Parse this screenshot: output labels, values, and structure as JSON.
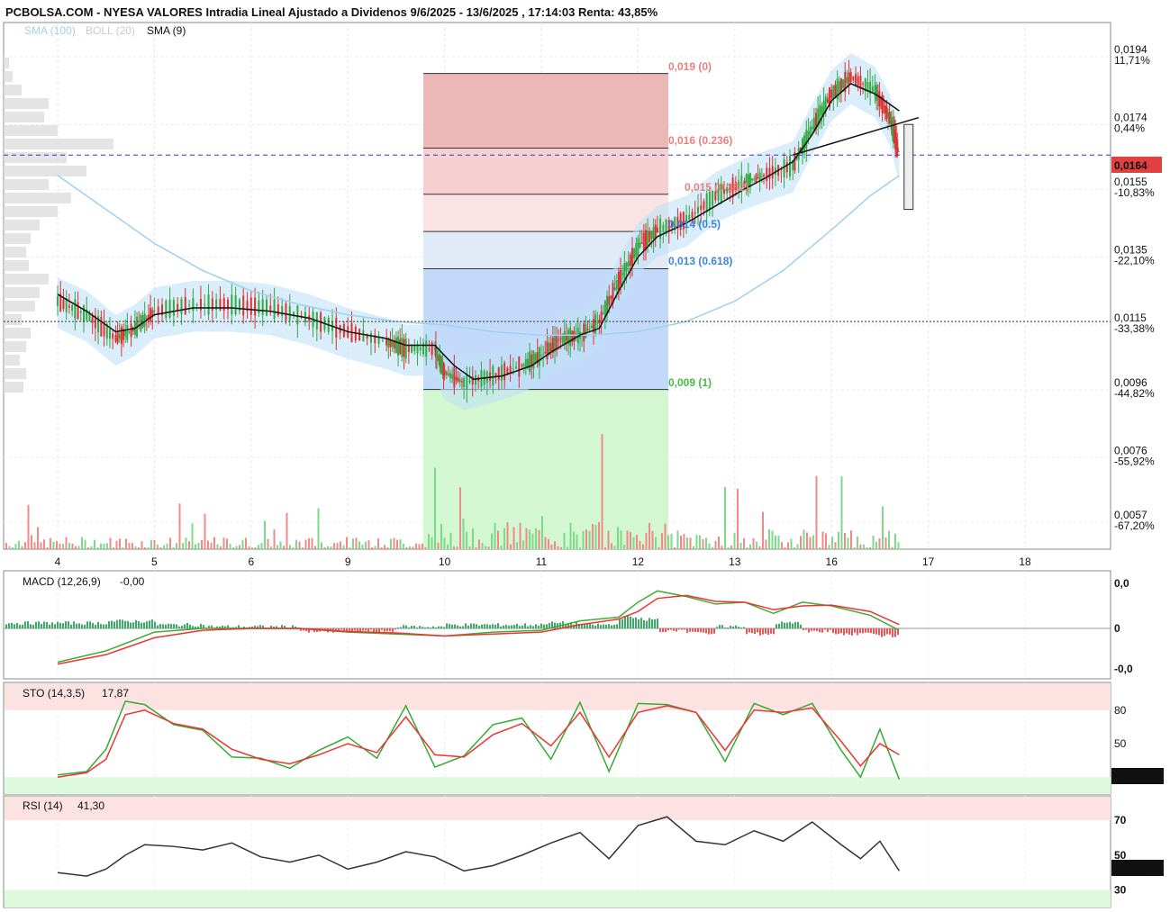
{
  "chart_data": [
    {
      "type": "candlestick",
      "title": "PCBOLSA.COM - NYESA VALORES Intradia Lineal Ajustado a Dividenos 9/6/2025 - 13/6/2025 , 17:14:03 Renta: 43,85%",
      "legend": [
        "SMA (100)",
        "BOLL (20)",
        "SMA (9)"
      ],
      "x_ticks": [
        "4",
        "5",
        "6",
        "9",
        "10",
        "11",
        "12",
        "13",
        "16",
        "17",
        "18"
      ],
      "y_ticks": [
        "0,0194",
        "0,0174",
        "0,0155",
        "0,0135",
        "0,0115",
        "0,0096",
        "0,0076",
        "0,0057"
      ],
      "y_pct": [
        "11,71%",
        "0,44%",
        "-10,83%",
        "-22,10%",
        "-33,38%",
        "-44,82%",
        "-55,92%",
        "-67,20%"
      ],
      "ylim": [
        0.0048,
        0.0203
      ],
      "last_price": "0,0164",
      "last_value": 0.0164,
      "reference_value": 0.0115,
      "fibonacci": {
        "high": 0.0188,
        "low": 0.0095,
        "labels": [
          "0,019 (0)",
          "0,016 (0.236)",
          "0,015 (0.382)",
          "0,014 (0.5)",
          "0,013 (0.618)",
          "0,009 (1)"
        ],
        "ratios": [
          0,
          0.236,
          0.382,
          0.5,
          0.618,
          1
        ]
      },
      "price_line": [
        [
          0,
          0.0121
        ],
        [
          0.3,
          0.0117
        ],
        [
          0.6,
          0.011
        ],
        [
          0.8,
          0.0113
        ],
        [
          1.0,
          0.0118
        ],
        [
          1.4,
          0.012
        ],
        [
          1.8,
          0.012
        ],
        [
          2.2,
          0.0119
        ],
        [
          2.6,
          0.0116
        ],
        [
          3.0,
          0.0112
        ],
        [
          3.4,
          0.0109
        ],
        [
          3.6,
          0.0107
        ],
        [
          3.9,
          0.0107
        ],
        [
          4.0,
          0.01
        ],
        [
          4.2,
          0.0097
        ],
        [
          4.5,
          0.0099
        ],
        [
          4.8,
          0.0102
        ],
        [
          5.0,
          0.0105
        ],
        [
          5.2,
          0.011
        ],
        [
          5.4,
          0.0111
        ],
        [
          5.6,
          0.0115
        ],
        [
          5.8,
          0.0127
        ],
        [
          6.0,
          0.0137
        ],
        [
          6.2,
          0.0142
        ],
        [
          6.5,
          0.0145
        ],
        [
          6.8,
          0.0152
        ],
        [
          7.1,
          0.0156
        ],
        [
          7.3,
          0.0158
        ],
        [
          7.6,
          0.0161
        ],
        [
          7.8,
          0.0172
        ],
        [
          8.0,
          0.0182
        ],
        [
          8.2,
          0.0187
        ],
        [
          8.45,
          0.0183
        ],
        [
          8.6,
          0.0175
        ],
        [
          8.7,
          0.0164
        ]
      ],
      "sma9": [
        [
          0,
          0.0123
        ],
        [
          0.3,
          0.0118
        ],
        [
          0.6,
          0.0112
        ],
        [
          0.8,
          0.0113
        ],
        [
          1.0,
          0.0117
        ],
        [
          1.4,
          0.0119
        ],
        [
          1.8,
          0.0119
        ],
        [
          2.2,
          0.0118
        ],
        [
          2.6,
          0.0116
        ],
        [
          3.0,
          0.0112
        ],
        [
          3.4,
          0.011
        ],
        [
          3.6,
          0.0108
        ],
        [
          3.9,
          0.0108
        ],
        [
          4.1,
          0.0102
        ],
        [
          4.3,
          0.0098
        ],
        [
          4.6,
          0.0099
        ],
        [
          4.9,
          0.0102
        ],
        [
          5.1,
          0.0106
        ],
        [
          5.4,
          0.0111
        ],
        [
          5.6,
          0.0113
        ],
        [
          5.8,
          0.0124
        ],
        [
          6.0,
          0.0134
        ],
        [
          6.2,
          0.014
        ],
        [
          6.5,
          0.0144
        ],
        [
          6.8,
          0.0149
        ],
        [
          7.1,
          0.0154
        ],
        [
          7.3,
          0.0157
        ],
        [
          7.6,
          0.0162
        ],
        [
          7.8,
          0.017
        ],
        [
          8.0,
          0.018
        ],
        [
          8.2,
          0.0185
        ],
        [
          8.45,
          0.0182
        ],
        [
          8.7,
          0.0177
        ]
      ],
      "sma100": [
        [
          0,
          0.0158
        ],
        [
          0.5,
          0.0148
        ],
        [
          1.0,
          0.0138
        ],
        [
          1.5,
          0.013
        ],
        [
          2.0,
          0.0124
        ],
        [
          2.5,
          0.012
        ],
        [
          3.0,
          0.0117
        ],
        [
          3.5,
          0.0115
        ],
        [
          4.0,
          0.0114
        ],
        [
          4.5,
          0.0112
        ],
        [
          5.0,
          0.0111
        ],
        [
          5.5,
          0.0111
        ],
        [
          6.0,
          0.0112
        ],
        [
          6.5,
          0.0115
        ],
        [
          7.0,
          0.0121
        ],
        [
          7.5,
          0.013
        ],
        [
          8.0,
          0.0142
        ],
        [
          8.4,
          0.0152
        ],
        [
          8.7,
          0.0158
        ]
      ],
      "trendline": [
        [
          7.6,
          0.0164
        ],
        [
          8.9,
          0.0175
        ]
      ]
    },
    {
      "type": "line",
      "title": "MACD (12,26,9)",
      "value": "-0,00",
      "y_ticks": [
        "0,0",
        "0",
        "-0,0"
      ],
      "macd": [
        [
          0,
          -0.9
        ],
        [
          0.5,
          -0.6
        ],
        [
          1.0,
          -0.1
        ],
        [
          1.5,
          0.0
        ],
        [
          2.0,
          0.0
        ],
        [
          2.5,
          0.0
        ],
        [
          3.0,
          -0.1
        ],
        [
          3.5,
          -0.15
        ],
        [
          4.0,
          -0.2
        ],
        [
          4.5,
          -0.1
        ],
        [
          5.0,
          -0.05
        ],
        [
          5.4,
          0.2
        ],
        [
          5.8,
          0.3
        ],
        [
          6.0,
          0.7
        ],
        [
          6.2,
          1.0
        ],
        [
          6.5,
          0.85
        ],
        [
          6.8,
          0.65
        ],
        [
          7.1,
          0.7
        ],
        [
          7.4,
          0.4
        ],
        [
          7.7,
          0.7
        ],
        [
          8.0,
          0.6
        ],
        [
          8.4,
          0.35
        ],
        [
          8.7,
          -0.05
        ]
      ],
      "signal": [
        [
          0,
          -0.95
        ],
        [
          0.5,
          -0.7
        ],
        [
          1.0,
          -0.25
        ],
        [
          1.5,
          -0.05
        ],
        [
          2.0,
          0.0
        ],
        [
          2.5,
          0.0
        ],
        [
          3.0,
          -0.08
        ],
        [
          3.5,
          -0.12
        ],
        [
          4.0,
          -0.2
        ],
        [
          4.5,
          -0.15
        ],
        [
          5.0,
          -0.1
        ],
        [
          5.4,
          0.1
        ],
        [
          5.8,
          0.25
        ],
        [
          6.0,
          0.45
        ],
        [
          6.2,
          0.8
        ],
        [
          6.5,
          0.88
        ],
        [
          6.8,
          0.72
        ],
        [
          7.1,
          0.7
        ],
        [
          7.4,
          0.5
        ],
        [
          7.7,
          0.6
        ],
        [
          8.0,
          0.62
        ],
        [
          8.4,
          0.45
        ],
        [
          8.7,
          0.1
        ]
      ],
      "ylim": [
        -1.2,
        1.2
      ]
    },
    {
      "type": "line",
      "title": "STO (14,3,5)",
      "value": "17,87",
      "last_value": "17,874",
      "y_ticks": [
        "80",
        "50"
      ],
      "ylim": [
        0,
        100
      ],
      "k": [
        [
          0,
          22
        ],
        [
          0.3,
          25
        ],
        [
          0.5,
          45
        ],
        [
          0.7,
          88
        ],
        [
          0.9,
          85
        ],
        [
          1.2,
          67
        ],
        [
          1.5,
          62
        ],
        [
          1.8,
          38
        ],
        [
          2.1,
          37
        ],
        [
          2.4,
          28
        ],
        [
          2.7,
          44
        ],
        [
          3.0,
          56
        ],
        [
          3.3,
          37
        ],
        [
          3.6,
          84
        ],
        [
          3.9,
          29
        ],
        [
          4.2,
          39
        ],
        [
          4.5,
          67
        ],
        [
          4.8,
          73
        ],
        [
          5.1,
          36
        ],
        [
          5.4,
          87
        ],
        [
          5.7,
          25
        ],
        [
          6.0,
          86
        ],
        [
          6.3,
          85
        ],
        [
          6.6,
          78
        ],
        [
          6.9,
          34
        ],
        [
          7.2,
          86
        ],
        [
          7.5,
          76
        ],
        [
          7.8,
          86
        ],
        [
          8.1,
          44
        ],
        [
          8.3,
          20
        ],
        [
          8.5,
          63
        ],
        [
          8.7,
          18
        ]
      ],
      "d": [
        [
          0,
          20
        ],
        [
          0.3,
          24
        ],
        [
          0.5,
          36
        ],
        [
          0.7,
          76
        ],
        [
          0.9,
          80
        ],
        [
          1.2,
          68
        ],
        [
          1.5,
          63
        ],
        [
          1.8,
          45
        ],
        [
          2.1,
          36
        ],
        [
          2.4,
          32
        ],
        [
          2.7,
          40
        ],
        [
          3.0,
          50
        ],
        [
          3.3,
          42
        ],
        [
          3.6,
          74
        ],
        [
          3.9,
          40
        ],
        [
          4.2,
          38
        ],
        [
          4.5,
          58
        ],
        [
          4.8,
          68
        ],
        [
          5.1,
          48
        ],
        [
          5.4,
          78
        ],
        [
          5.7,
          38
        ],
        [
          6.0,
          78
        ],
        [
          6.3,
          84
        ],
        [
          6.6,
          78
        ],
        [
          6.9,
          44
        ],
        [
          7.2,
          80
        ],
        [
          7.5,
          78
        ],
        [
          7.8,
          82
        ],
        [
          8.1,
          52
        ],
        [
          8.3,
          30
        ],
        [
          8.5,
          50
        ],
        [
          8.7,
          40
        ]
      ]
    },
    {
      "type": "line",
      "title": "RSI (14)",
      "value": "41,30",
      "last_value": "41,309",
      "y_ticks": [
        "70",
        "50",
        "30"
      ],
      "ylim": [
        20,
        84
      ],
      "rsi": [
        [
          0,
          40
        ],
        [
          0.3,
          38
        ],
        [
          0.5,
          42
        ],
        [
          0.7,
          50
        ],
        [
          0.9,
          56
        ],
        [
          1.2,
          55
        ],
        [
          1.5,
          53
        ],
        [
          1.8,
          57
        ],
        [
          2.1,
          49
        ],
        [
          2.4,
          46
        ],
        [
          2.7,
          50
        ],
        [
          3.0,
          42
        ],
        [
          3.3,
          46
        ],
        [
          3.6,
          52
        ],
        [
          3.9,
          49
        ],
        [
          4.2,
          41
        ],
        [
          4.5,
          44
        ],
        [
          4.8,
          50
        ],
        [
          5.1,
          57
        ],
        [
          5.4,
          63
        ],
        [
          5.7,
          48
        ],
        [
          6.0,
          67
        ],
        [
          6.3,
          72
        ],
        [
          6.6,
          58
        ],
        [
          6.9,
          56
        ],
        [
          7.2,
          64
        ],
        [
          7.5,
          58
        ],
        [
          7.8,
          69
        ],
        [
          8.1,
          56
        ],
        [
          8.3,
          48
        ],
        [
          8.5,
          58
        ],
        [
          8.7,
          41
        ]
      ]
    }
  ],
  "colors": {
    "up": "#44bb44",
    "down": "#ee4444",
    "sma100": "#9fd0ee",
    "sma9": "#111111",
    "boll_fill": "#bfe1f7",
    "last_price_bg": "#e04040",
    "fib_red": "#e8a0a0",
    "fib_blue": "#5b9ef2",
    "fib_green": "#b6f0b0"
  }
}
